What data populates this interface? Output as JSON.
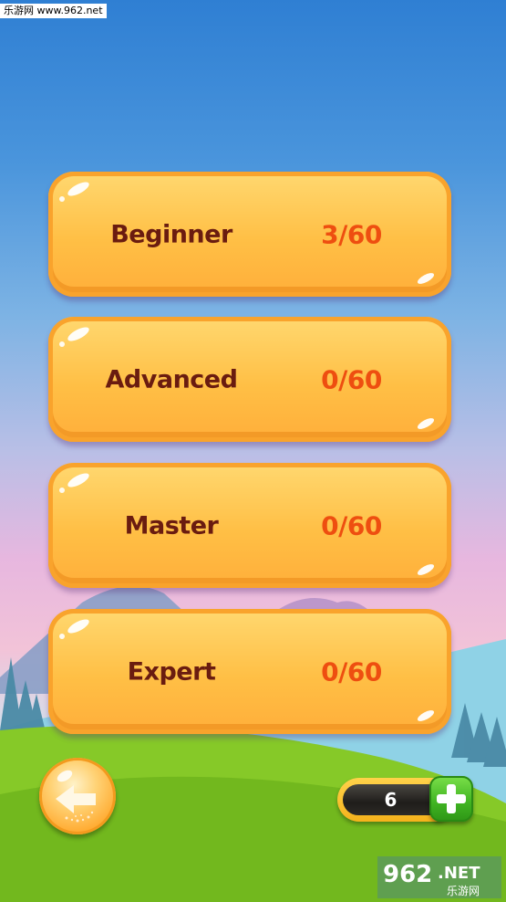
{
  "watermark": {
    "top_text": "乐游网 www.962.net",
    "logo_main": "962",
    "logo_suffix": ".NET",
    "logo_sub": "乐游网"
  },
  "levels": [
    {
      "name": "Beginner",
      "progress": "3/60"
    },
    {
      "name": "Advanced",
      "progress": "0/60"
    },
    {
      "name": "Master",
      "progress": "0/60"
    },
    {
      "name": "Expert",
      "progress": "0/60"
    }
  ],
  "coins": {
    "value": "6"
  },
  "icons": {
    "back": "back-arrow-icon",
    "add": "plus-icon"
  },
  "colors": {
    "card": "#ffbf45",
    "level_name": "#6a1c10",
    "progress": "#ee4e10",
    "add_button": "#3fb321"
  }
}
